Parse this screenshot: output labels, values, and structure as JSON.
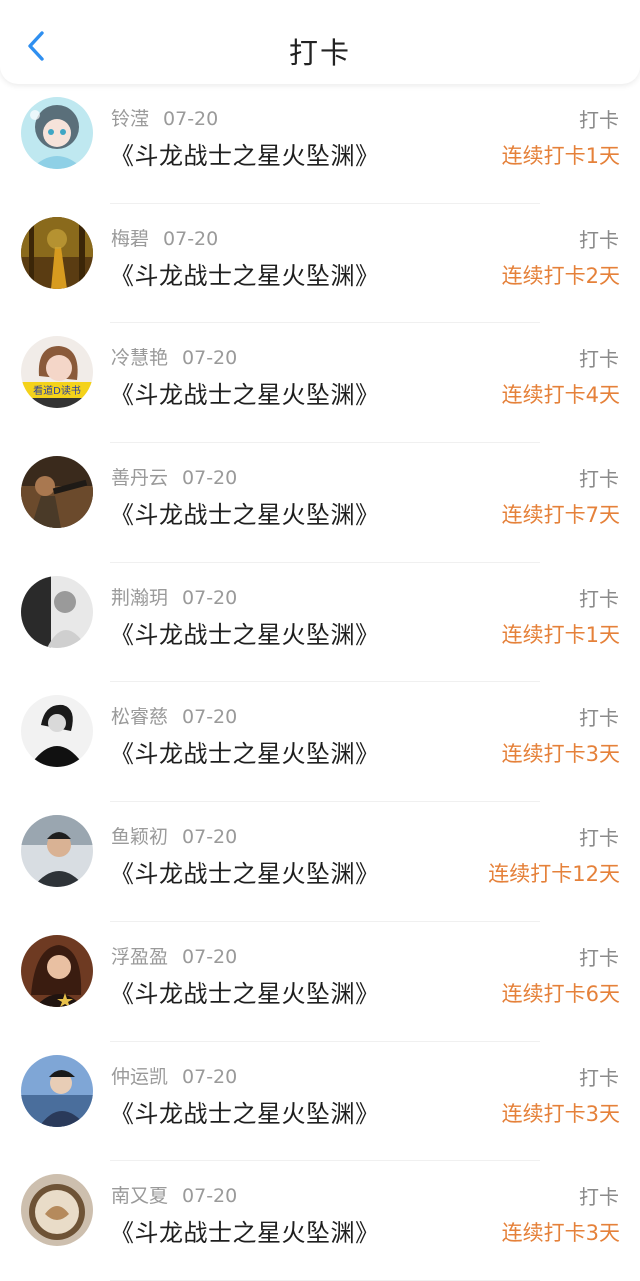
{
  "header": {
    "title": "打卡",
    "back_icon": "chevron-left-icon"
  },
  "colors": {
    "accent_blue": "#2f8ff0",
    "streak_orange": "#e5813a"
  },
  "entries": [
    {
      "user": "铃滢",
      "date": "07-20",
      "book": "《斗龙战士之星火坠渊》",
      "action": "打卡",
      "streak": "连续打卡1天"
    },
    {
      "user": "梅碧",
      "date": "07-20",
      "book": "《斗龙战士之星火坠渊》",
      "action": "打卡",
      "streak": "连续打卡2天"
    },
    {
      "user": "冷慧艳",
      "date": "07-20",
      "book": "《斗龙战士之星火坠渊》",
      "action": "打卡",
      "streak": "连续打卡4天",
      "avatar_caption": "看道D读书"
    },
    {
      "user": "善丹云",
      "date": "07-20",
      "book": "《斗龙战士之星火坠渊》",
      "action": "打卡",
      "streak": "连续打卡7天"
    },
    {
      "user": "荆瀚玥",
      "date": "07-20",
      "book": "《斗龙战士之星火坠渊》",
      "action": "打卡",
      "streak": "连续打卡1天"
    },
    {
      "user": "松睿慈",
      "date": "07-20",
      "book": "《斗龙战士之星火坠渊》",
      "action": "打卡",
      "streak": "连续打卡3天"
    },
    {
      "user": "鱼颖初",
      "date": "07-20",
      "book": "《斗龙战士之星火坠渊》",
      "action": "打卡",
      "streak": "连续打卡12天"
    },
    {
      "user": "浮盈盈",
      "date": "07-20",
      "book": "《斗龙战士之星火坠渊》",
      "action": "打卡",
      "streak": "连续打卡6天"
    },
    {
      "user": "仲运凯",
      "date": "07-20",
      "book": "《斗龙战士之星火坠渊》",
      "action": "打卡",
      "streak": "连续打卡3天"
    },
    {
      "user": "南又夏",
      "date": "07-20",
      "book": "《斗龙战士之星火坠渊》",
      "action": "打卡",
      "streak": "连续打卡3天"
    }
  ]
}
